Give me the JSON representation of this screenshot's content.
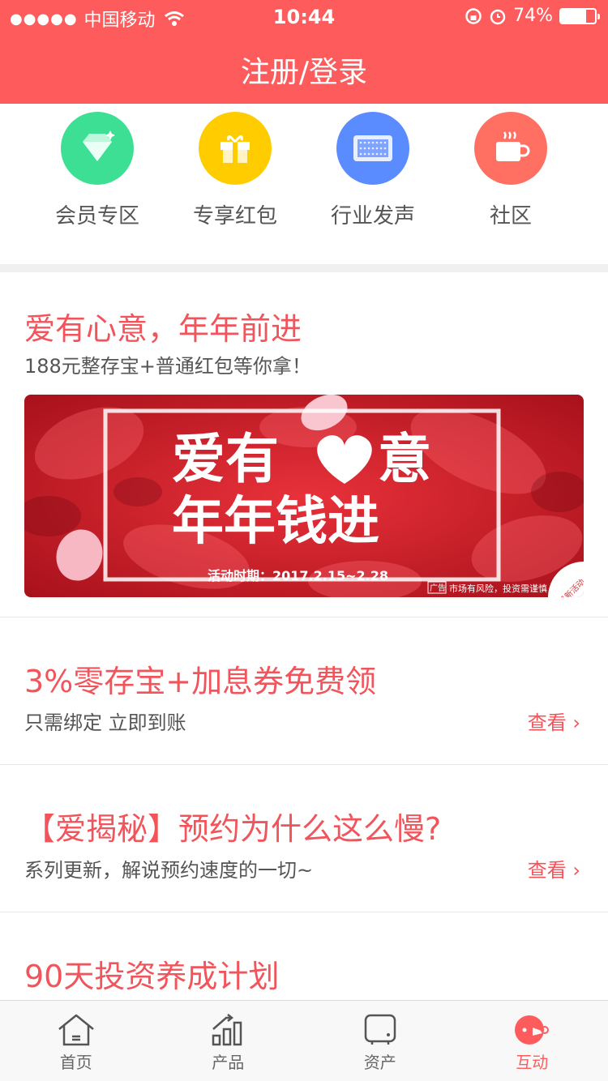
{
  "status_bar": {
    "signal": "●●●●●",
    "carrier": "中国移动",
    "time": "10:44",
    "battery_pct": "74%",
    "battery_level": 0.74
  },
  "header": {
    "title": "注册/登录"
  },
  "quick_links": [
    {
      "label": "会员专区",
      "icon": "diamond-icon",
      "color": "#3ddf95"
    },
    {
      "label": "专享红包",
      "icon": "gift-icon",
      "color": "#ffcc00"
    },
    {
      "label": "行业发声",
      "icon": "speaker-icon",
      "color": "#5b8cff"
    },
    {
      "label": "社区",
      "icon": "coffee-cup-icon",
      "color": "#ff7063"
    }
  ],
  "article1": {
    "title": "爱有心意，年年前进",
    "subtitle": "188元整存宝+普通红包等你拿！",
    "banner": {
      "line1_a": "爱有",
      "line1_b": "意",
      "line2": "年年钱进",
      "period": "活动时期：2017.2.15~2.28",
      "ad_tag": "广告",
      "risk": "市场有风险，投资需谨慎",
      "corner": "最新活动"
    }
  },
  "articles": [
    {
      "title": "3%零存宝+加息券免费领",
      "subtitle": "只需绑定  立即到账",
      "link": "查看"
    },
    {
      "title": "【爱揭秘】预约为什么这么慢?",
      "subtitle": "系列更新，解说预约速度的一切~",
      "link": "查看"
    },
    {
      "title": "90天投资养成计划"
    }
  ],
  "tabbar": [
    {
      "label": "首页",
      "icon": "home-icon"
    },
    {
      "label": "产品",
      "icon": "bar-chart-icon"
    },
    {
      "label": "资产",
      "icon": "safe-icon"
    },
    {
      "label": "互动",
      "icon": "chat-bubble-icon",
      "active": true
    }
  ],
  "colors": {
    "accent": "#fe5c5c",
    "title_red": "#f2545b"
  }
}
